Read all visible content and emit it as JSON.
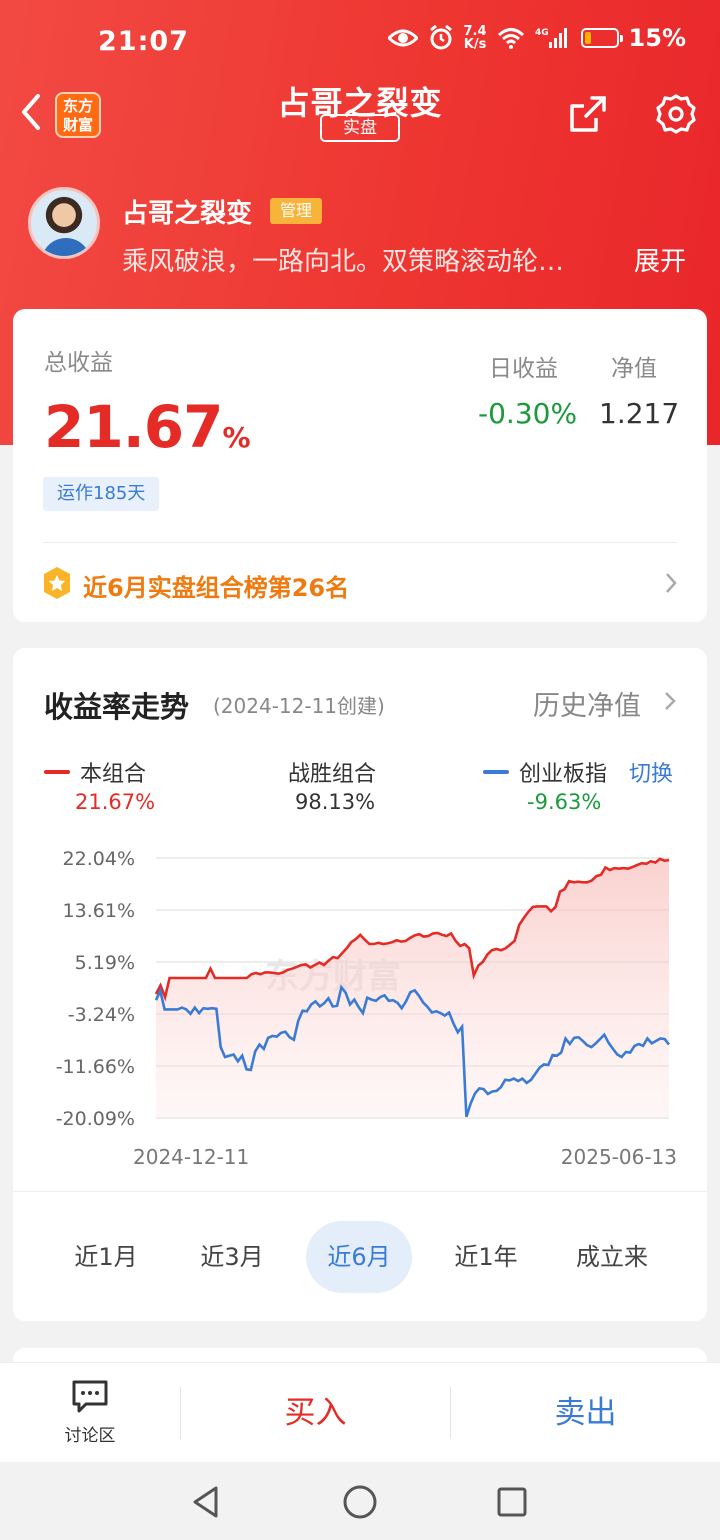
{
  "status_bar": {
    "time": "21:07",
    "net_speed_value": "7.4",
    "net_speed_unit": "K/s",
    "network": "4G",
    "battery": "15%"
  },
  "header": {
    "title": "占哥之裂变",
    "tag": "实盘",
    "logo_line1": "东方",
    "logo_line2": "财富"
  },
  "profile": {
    "name": "占哥之裂变",
    "badge": "管理",
    "description": "乘风破浪，一路向北。双策略滚动轮…",
    "expand": "展开"
  },
  "summary": {
    "total_label": "总收益",
    "total_value": "21.67",
    "total_unit": "%",
    "daily_label": "日收益",
    "daily_value": "-0.30%",
    "nav_label": "净值",
    "nav_value": "1.217",
    "running": "运作185天",
    "rank": "近6月实盘组合榜第26名"
  },
  "trend": {
    "title": "收益率走势",
    "created": "(2024-12-11创建)",
    "history": "历史净值",
    "legend": [
      {
        "name": "本组合",
        "value": "21.67%",
        "color": "#e42b26"
      },
      {
        "name": "战胜组合",
        "value": "98.13%"
      },
      {
        "name": "创业板指",
        "value": "-9.63%",
        "color": "#3a7bd5"
      }
    ],
    "switch": "切换",
    "watermark": "东方财富",
    "periods": [
      "近1月",
      "近3月",
      "近6月",
      "近1年",
      "成立来"
    ],
    "active_period": 2
  },
  "chart_data": {
    "type": "line",
    "x_start": "2024-12-11",
    "x_end": "2025-06-13",
    "yticks": [
      "22.04%",
      "13.61%",
      "5.19%",
      "-3.24%",
      "-11.66%",
      "-20.09%"
    ],
    "ylim": [
      -20.09,
      22.04
    ],
    "series": [
      {
        "name": "本组合",
        "color": "#e42b26",
        "values": [
          0,
          1.4,
          -0.5,
          2.6,
          2.6,
          2.6,
          2.6,
          2.6,
          2.6,
          2.6,
          2.6,
          2.6,
          4.1,
          2.6,
          2.6,
          2.6,
          2.6,
          2.6,
          2.6,
          2.6,
          2.6,
          3.2,
          3.4,
          3.2,
          3.5,
          3.5,
          3.4,
          3.3,
          3.5,
          3.9,
          4.1,
          4.4,
          4.7,
          4.8,
          4.3,
          4.7,
          5.1,
          4.7,
          5.4,
          6.0,
          5.8,
          6.6,
          7.4,
          8.4,
          8.9,
          9.6,
          8.8,
          8.1,
          8.1,
          8.3,
          8.1,
          8.2,
          8.4,
          8.7,
          8.5,
          8.6,
          9.1,
          9.5,
          9.7,
          9.3,
          9.4,
          9.8,
          9.9,
          9.6,
          9.4,
          9.8,
          8.6,
          7.8,
          8.1,
          7.4,
          3.0,
          4.6,
          5.2,
          6.4,
          7.1,
          7.3,
          7.1,
          7.4,
          8.0,
          8.6,
          11.2,
          12.3,
          13.3,
          14.1,
          14.2,
          14.2,
          14.2,
          13.4,
          14.1,
          16.6,
          17.0,
          18.3,
          18.1,
          18.2,
          18.1,
          18.1,
          18.4,
          19.1,
          19.3,
          20.5,
          20.1,
          20.4,
          20.3,
          20.4,
          20.3,
          20.6,
          20.9,
          21.2,
          21.1,
          21.5,
          21.3,
          21.9,
          21.6,
          21.7
        ]
      },
      {
        "name": "创业板指",
        "color": "#3a7bd5",
        "values": [
          -1,
          0.5,
          -2.5,
          -2.5,
          -2.5,
          -2.5,
          -2.2,
          -2.5,
          -3.2,
          -2.2,
          -3.1,
          -2.3,
          -2.4,
          -2.3,
          -2.4,
          -8.6,
          -10.2,
          -10.0,
          -9.8,
          -10.9,
          -10.0,
          -12.2,
          -12.3,
          -9.3,
          -8.2,
          -8.9,
          -7.1,
          -6.8,
          -6.9,
          -6.3,
          -6.1,
          -7.0,
          -7.4,
          -4.3,
          -2.7,
          -2.8,
          -1.7,
          -1.2,
          -2.0,
          -1.5,
          -0.7,
          -2.0,
          -1.9,
          1.1,
          0.2,
          -1.7,
          -0.9,
          -2.1,
          -3.1,
          -0.6,
          -0.9,
          -1.1,
          -0.5,
          -0.2,
          -1.1,
          -1.0,
          -1.4,
          -2.3,
          -1.2,
          0.3,
          0.6,
          -0.3,
          -1.4,
          -2.1,
          -3.0,
          -2.8,
          -3.1,
          -3.5,
          -3.0,
          -4.8,
          -6.2,
          -5.3,
          -19.9,
          -17.7,
          -16.1,
          -15.3,
          -15.4,
          -16.2,
          -15.8,
          -15.7,
          -15.1,
          -13.9,
          -14.0,
          -13.7,
          -14.1,
          -13.7,
          -14.4,
          -13.9,
          -12.9,
          -11.9,
          -11.4,
          -11.5,
          -9.9,
          -10.0,
          -9.5,
          -7.2,
          -8.1,
          -7.1,
          -7.0,
          -7.6,
          -8.3,
          -8.6,
          -8.0,
          -7.3,
          -6.6,
          -7.9,
          -8.9,
          -9.8,
          -10.2,
          -9.4,
          -9.5,
          -8.4,
          -8.1,
          -8.4,
          -7.2,
          -8.0,
          -7.6,
          -7.2,
          -7.3,
          -8.2
        ]
      }
    ]
  },
  "actions": {
    "discussion": "讨论区",
    "buy": "买入",
    "sell": "卖出"
  }
}
